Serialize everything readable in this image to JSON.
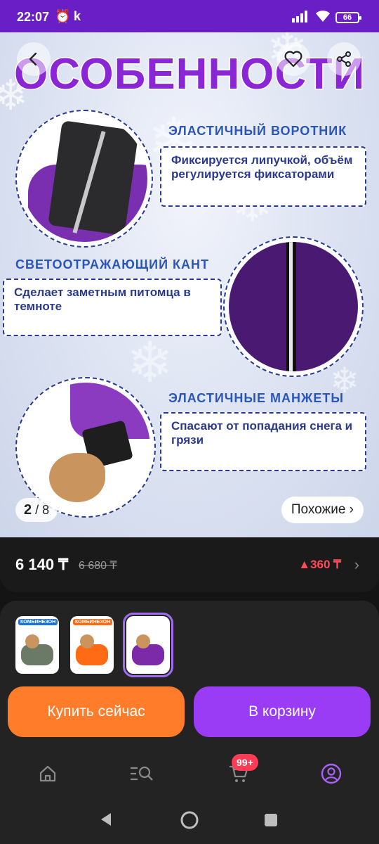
{
  "status_bar": {
    "time": "22:07",
    "alarm_icon": "alarm-icon",
    "carrier_letter": "k",
    "battery": "66"
  },
  "hero": {
    "title": "ОСОБЕННОСТИ",
    "features": [
      {
        "title": "ЭЛАСТИЧНЫЙ ВОРОТНИК",
        "text": "Фиксируется липучкой, объём регулируется фиксаторами"
      },
      {
        "title": "СВЕТООТРАЖАЮЩИЙ КАНТ",
        "text": "Сделает заметным питомца в темноте"
      },
      {
        "title": "ЭЛАСТИЧНЫЕ МАНЖЕТЫ",
        "text": "Спасают от попадания снега и грязи"
      }
    ],
    "pager_current": "2",
    "pager_total": "8",
    "similar_label": "Похожие ›"
  },
  "price": {
    "current": "6 140 ₸",
    "old": "6 680 ₸",
    "diff": "▲360 ₸"
  },
  "thumbnails": [
    {
      "header": "КОМБИНЕЗОН",
      "color": "#6b7a66",
      "accent": "#1b74d6"
    },
    {
      "header": "КОМБИНЕЗОН",
      "color": "#ff6a14",
      "accent": "#ff6a14"
    },
    {
      "header": "",
      "color": "#7c2aa8",
      "accent": "#7c2aa8"
    }
  ],
  "actions": {
    "buy_now": "Купить сейчас",
    "add_to_cart": "В корзину"
  },
  "bottom_nav": {
    "cart_badge": "99+"
  },
  "colors": {
    "accent_purple": "#9a3cf5",
    "accent_orange": "#ff7d2a",
    "title_purple": "#8b26d6",
    "price_diff": "#ff4a5a"
  }
}
